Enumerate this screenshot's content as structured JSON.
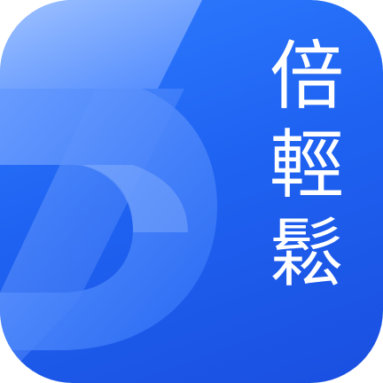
{
  "app_icon": {
    "brand_chars": [
      "倍",
      "輕",
      "鬆"
    ],
    "mark_icon": "stylized-number-3-icon",
    "colors": {
      "background_top": "#2f7dff",
      "background_bottom": "#1a4fe0",
      "mark_light": "#8fb6ff",
      "mark_mid": "#5b91ff",
      "text": "#ffffff"
    }
  }
}
